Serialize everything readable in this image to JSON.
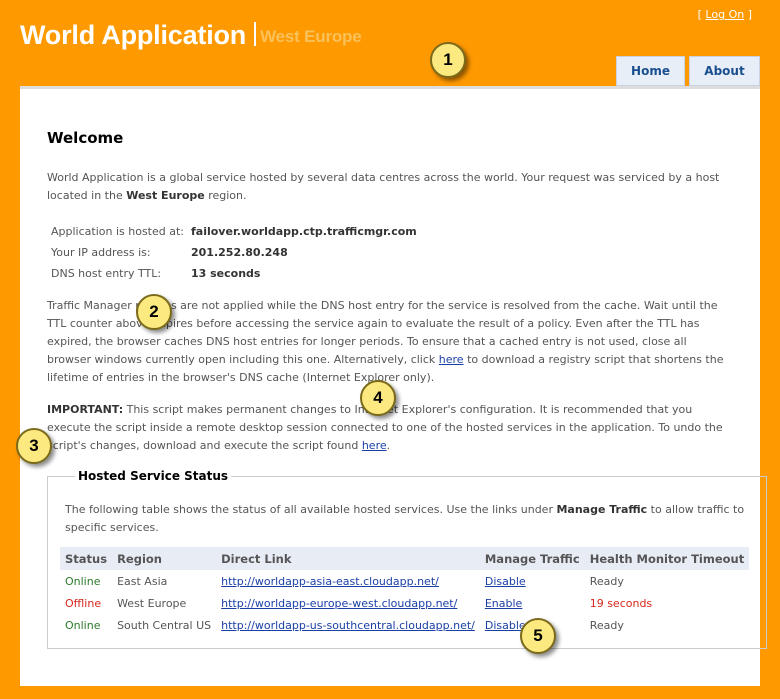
{
  "header": {
    "title": "World Application",
    "region": "West Europe",
    "login_open": "[ ",
    "login_label": "Log On",
    "login_close": " ]"
  },
  "menu": {
    "home": "Home",
    "about": "About"
  },
  "welcome": {
    "heading": "Welcome",
    "intro_1": "World Application is a global service hosted by several data centres across the world. Your request was serviced by a host located in the ",
    "intro_region": "West Europe",
    "intro_2": " region."
  },
  "info": [
    {
      "label": "Application is hosted at:",
      "value": "failover.worldapp.ctp.trafficmgr.com"
    },
    {
      "label": "Your IP address is:",
      "value": "201.252.80.248"
    },
    {
      "label": "DNS host entry TTL:",
      "value": "13 seconds"
    }
  ],
  "para2": {
    "before": "Traffic Manager policies are not applied while the DNS host entry for the service is resolved from the cache. Wait until the TTL counter above expires before accessing the service again to evaluate the result of a policy. Even after the TTL has expired, the browser caches DNS host entries for longer periods. To ensure that a cached entry is not used, close all browser windows currently open including this one. Alternatively, click ",
    "link": "here",
    "after": " to download a registry script that shortens the lifetime of entries in the browser's DNS cache (Internet Explorer only)."
  },
  "para3": {
    "important": "IMPORTANT:",
    "before": " This script makes permanent changes to Internet Explorer's configuration. It is recommended that you execute the script inside a remote desktop session connected to one of the hosted services in the application. To undo the script's changes, download and execute the script found ",
    "link": "here",
    "after": "."
  },
  "hosted": {
    "legend": "Hosted Service Status",
    "desc_1": "The following table shows the status of all available hosted services. Use the links under ",
    "desc_bold": "Manage Traffic",
    "desc_2": " to allow traffic to specific services.",
    "columns": [
      "Status",
      "Region",
      "Direct Link",
      "Manage Traffic",
      "Health Monitor Timeout"
    ],
    "rows": [
      {
        "status": "Online",
        "region": "East Asia",
        "link": "http://worldapp-asia-east.cloudapp.net/",
        "manage": "Disable",
        "timeout": "Ready"
      },
      {
        "status": "Offline",
        "region": "West Europe",
        "link": "http://worldapp-europe-west.cloudapp.net/",
        "manage": "Enable",
        "timeout": "19 seconds"
      },
      {
        "status": "Online",
        "region": "South Central US",
        "link": "http://worldapp-us-southcentral.cloudapp.net/",
        "manage": "Disable",
        "timeout": "Ready"
      }
    ]
  },
  "callouts": [
    "1",
    "2",
    "3",
    "4",
    "5"
  ],
  "colors": {
    "background": "#ff9900",
    "online": "#2d7a2d",
    "offline": "#d6261b",
    "link": "#1a3fa6"
  }
}
